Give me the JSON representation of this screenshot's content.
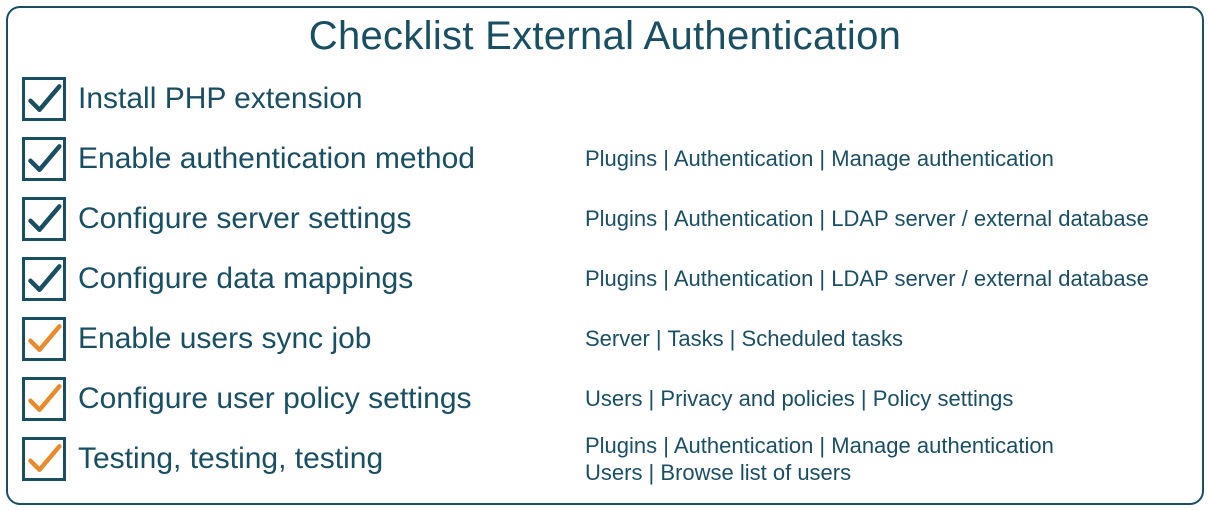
{
  "title": "Checklist External Authentication",
  "colors": {
    "primary": "#1a4f63",
    "accent": "#e88b2e"
  },
  "items": [
    {
      "label": "Install PHP extension",
      "path": "",
      "check_color": "dark"
    },
    {
      "label": "Enable authentication method",
      "path": "Plugins | Authentication | Manage authentication",
      "check_color": "dark"
    },
    {
      "label": "Configure server settings",
      "path": "Plugins | Authentication | LDAP server / external database",
      "check_color": "dark"
    },
    {
      "label": "Configure data mappings",
      "path": "Plugins | Authentication | LDAP server / external database",
      "check_color": "dark"
    },
    {
      "label": "Enable users sync job",
      "path": "Server | Tasks | Scheduled tasks",
      "check_color": "orange"
    },
    {
      "label": "Configure user policy settings",
      "path": "Users | Privacy and policies | Policy settings",
      "check_color": "orange"
    },
    {
      "label": "Testing, testing, testing",
      "path": "Plugins | Authentication | Manage authentication\nUsers | Browse list of users",
      "check_color": "orange"
    }
  ]
}
